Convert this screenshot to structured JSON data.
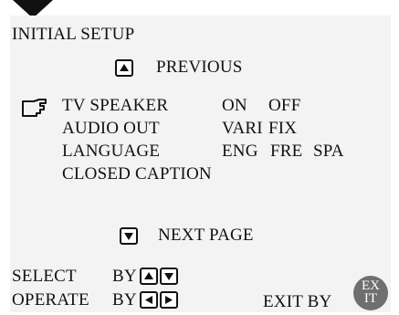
{
  "menu": {
    "title": "INITIAL SETUP",
    "previous_label": "PREVIOUS",
    "next_label": "NEXT PAGE",
    "items": [
      {
        "label": "TV SPEAKER",
        "options": [
          "ON",
          "OFF"
        ]
      },
      {
        "label": "AUDIO OUT",
        "options": [
          "VARI",
          "FIX"
        ]
      },
      {
        "label": "LANGUAGE",
        "options": [
          "ENG",
          "FRE",
          "SPA"
        ]
      },
      {
        "label": "CLOSED CAPTION",
        "options": []
      }
    ],
    "select_label": "SELECT",
    "operate_label": "OPERATE",
    "by_label": "BY",
    "exit_by_label": "EXIT BY",
    "exit_badge": {
      "line1": "EX",
      "line2": "IT"
    }
  },
  "icons": {
    "cursor": "pointing-hand-icon",
    "up": "up-arrow-key-icon",
    "down": "down-arrow-key-icon",
    "left": "left-arrow-key-icon",
    "right": "right-arrow-key-icon"
  },
  "colors": {
    "background": "#f3f3f3",
    "text": "#111111",
    "exit_badge": "#6f6f6f"
  }
}
